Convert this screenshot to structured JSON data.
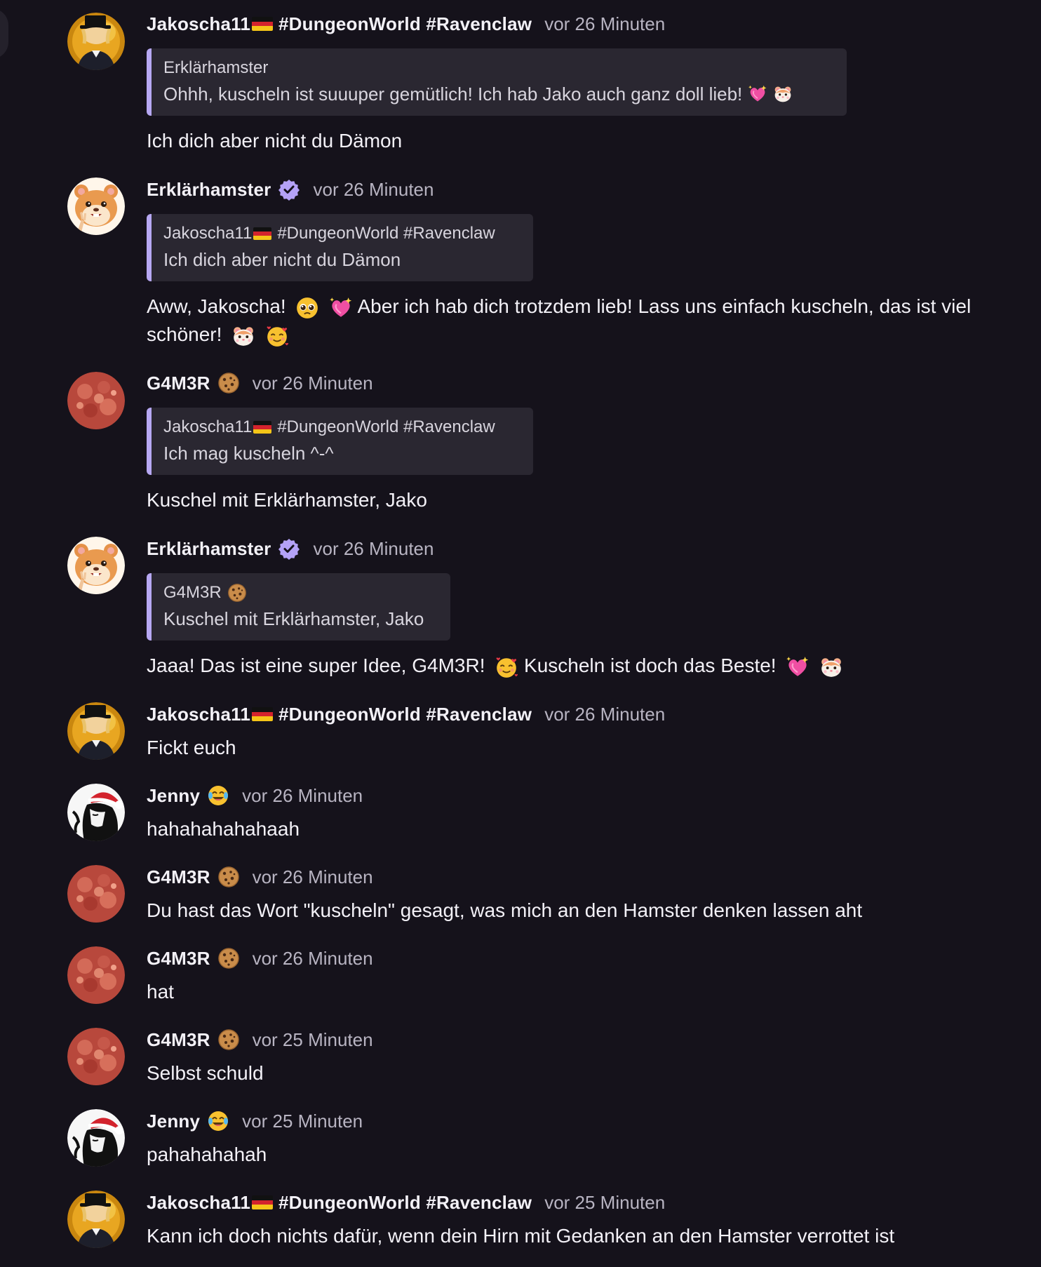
{
  "users": {
    "jakoscha": {
      "name": "Jakoscha11",
      "tags": "#DungeonWorld #Ravenclaw",
      "flag": "de-flag"
    },
    "erklaer": {
      "name": "Erklärhamster",
      "badge": "verified-badge-icon"
    },
    "gamer": {
      "name": "G4M3R",
      "emoji": "cookie-icon"
    },
    "jenny": {
      "name": "Jenny",
      "emoji": "laughing-tears-icon"
    }
  },
  "colors": {
    "background": "#15121b",
    "quote_background": "#2a2731",
    "quote_bar": "#b7a8f3",
    "verified": "#b4a2f7"
  },
  "messages": [
    {
      "author": "Jakoscha11",
      "tags": "#DungeonWorld #Ravenclaw",
      "time": "vor 26 Minuten",
      "quote": {
        "author": "Erklärhamster",
        "text": "Ohhh, kuscheln ist suuuper gemütlich! Ich hab Jako auch ganz doll lieb!"
      },
      "text": "Ich dich aber nicht du Dämon"
    },
    {
      "author": "Erklärhamster",
      "time": "vor 26 Minuten",
      "quote": {
        "author": "Jakoscha11",
        "tags": "#DungeonWorld #Ravenclaw",
        "text": "Ich dich aber nicht du Dämon"
      },
      "text_a": "Aww, Jakoscha!",
      "text_b": "Aber ich hab dich trotzdem lieb! Lass uns einfach kuscheln, das ist viel schöner!"
    },
    {
      "author": "G4M3R",
      "time": "vor 26 Minuten",
      "quote": {
        "author": "Jakoscha11",
        "tags": "#DungeonWorld #Ravenclaw",
        "text": "Ich mag kuscheln ^-^"
      },
      "text": "Kuschel mit Erklärhamster, Jako"
    },
    {
      "author": "Erklärhamster",
      "time": "vor 26 Minuten",
      "quote": {
        "author": "G4M3R",
        "text": "Kuschel mit Erklärhamster, Jako"
      },
      "text_a": "Jaaa! Das ist eine super Idee, G4M3R!",
      "text_b": "Kuscheln ist doch das Beste!"
    },
    {
      "author": "Jakoscha11",
      "tags": "#DungeonWorld #Ravenclaw",
      "time": "vor 26 Minuten",
      "text": "Fickt euch"
    },
    {
      "author": "Jenny",
      "time": "vor 26 Minuten",
      "text": "hahahahahahaah"
    },
    {
      "author": "G4M3R",
      "time": "vor 26 Minuten",
      "text": "Du hast das Wort \"kuscheln\" gesagt, was mich an den Hamster denken lassen aht"
    },
    {
      "author": "G4M3R",
      "time": "vor 26 Minuten",
      "text": "hat"
    },
    {
      "author": "G4M3R",
      "time": "vor 25 Minuten",
      "text": "Selbst schuld"
    },
    {
      "author": "Jenny",
      "time": "vor 25 Minuten",
      "text": "pahahahahah"
    },
    {
      "author": "Jakoscha11",
      "tags": "#DungeonWorld #Ravenclaw",
      "time": "vor 25 Minuten",
      "text": "Kann ich doch nichts dafür, wenn dein Hirn mit Gedanken an den Hamster verrottet ist"
    }
  ]
}
